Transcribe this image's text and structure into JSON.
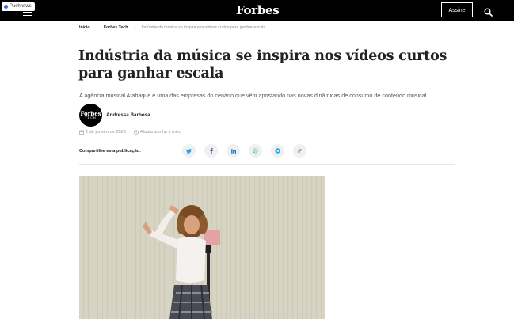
{
  "header": {
    "badge": "Pushnews",
    "logo": "Forbes",
    "subscribe_label": "Assine",
    "icons": [
      "hamburger-icon",
      "search-icon"
    ]
  },
  "breadcrumb": {
    "home": "Início",
    "section": "Forbes Tech",
    "current": "Indústria da música se inspira nos vídeos curtos para ganhar escala"
  },
  "article": {
    "title": "Indústria da música se inspira nos vídeos curtos para ganhar escala",
    "subtitle": "A agência musical Atabaque é uma das empresas do cenário que vêm apostando nas novas dinâmicas de consumo de conteúdo musical",
    "author": {
      "avatar_top": "Forbes",
      "avatar_bottom": "TECH",
      "name": "Andressa Barbosa"
    },
    "date": "2 de janeiro de 2023",
    "updated": "Atualizado há 1 mês"
  },
  "share": {
    "label": "Compartilhe esta publicação:",
    "networks": [
      "twitter-icon",
      "facebook-icon",
      "linkedin-icon",
      "whatsapp-icon",
      "telegram-icon",
      "link-icon"
    ]
  },
  "colors": {
    "header_bg": "#000000",
    "twitter": "#1da1f2",
    "facebook": "#3b5998",
    "linkedin": "#0a66c2",
    "whatsapp": "#25d366",
    "telegram": "#2aa3de",
    "link": "#777777",
    "photo_bg": "#d7d3c3"
  }
}
